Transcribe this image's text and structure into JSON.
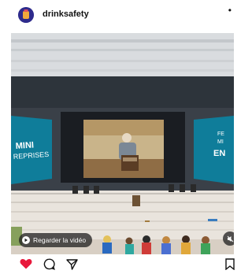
{
  "post": {
    "username": "drinksafety",
    "more_icon": "more-horizontal-icon"
  },
  "media": {
    "watch_label": "Regarder la vidéo",
    "left_banner_text": "MINI REPRISES",
    "right_banner_text": "FE MI EN"
  },
  "actions": {
    "like_icon": "heart-filled-icon",
    "comment_icon": "comment-icon",
    "share_icon": "send-icon",
    "save_icon": "bookmark-icon",
    "like_color": "#e8193c"
  }
}
